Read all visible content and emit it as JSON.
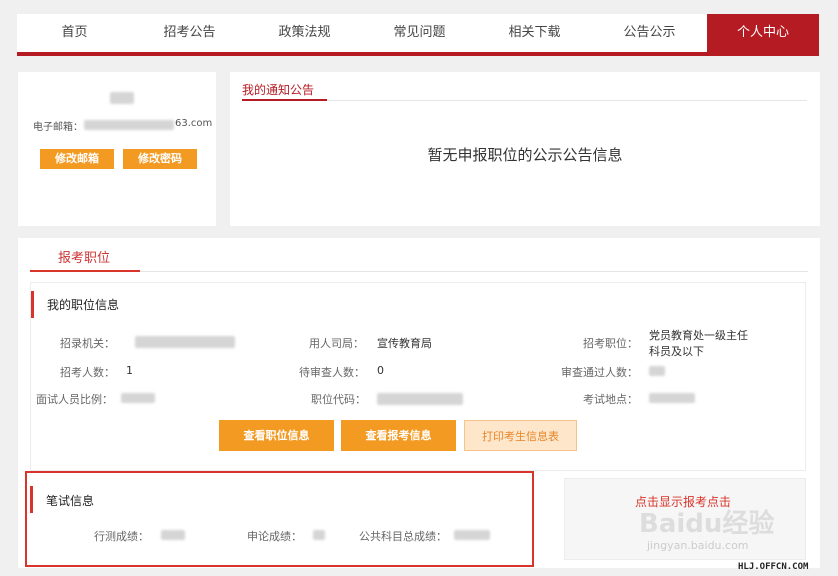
{
  "nav": {
    "items": [
      "首页",
      "招考公告",
      "政策法规",
      "常见问题",
      "相关下载",
      "公告公示",
      "个人中心"
    ],
    "active_index": 6
  },
  "profile": {
    "email_label": "电子邮箱：",
    "email_suffix": "63.com",
    "change_email": "修改邮箱",
    "change_password": "修改密码"
  },
  "notice": {
    "tab": "我的通知公告",
    "empty_text": "暂无申报职位的公示公告信息"
  },
  "position": {
    "tab": "报考职位",
    "section_title": "我的职位信息",
    "fields": {
      "agency_label": "招录机关：",
      "dept_label": "用人司局：",
      "dept_value": "宣传教育局",
      "post_label": "招考职位：",
      "post_value_line1": "党员教育处一级主任",
      "post_value_line2": "科员及以下",
      "recruit_num_label": "招考人数：",
      "recruit_num_value": "1",
      "pending_label": "待审查人数：",
      "pending_value": "0",
      "approved_label": "审查通过人数：",
      "ratio_label": "面试人员比例：",
      "code_label": "职位代码：",
      "location_label": "考试地点："
    },
    "buttons": {
      "view_position": "查看职位信息",
      "view_application": "查看报考信息",
      "print_info": "打印考生信息表"
    }
  },
  "written": {
    "section_title": "笔试信息",
    "xingce_label": "行测成绩：",
    "shenlun_label": "申论成绩：",
    "public_total_label": "公共科目总成绩："
  },
  "side": {
    "link_text": "点击显示报考点击"
  },
  "watermark": {
    "text1": "Baidu经验",
    "text2": "jingyan.baidu.com",
    "corner": "HLJ.OFFCN.COM"
  },
  "colors": {
    "brand": "#b51b22",
    "button": "#f39a23",
    "highlight_box": "#d9342b"
  }
}
